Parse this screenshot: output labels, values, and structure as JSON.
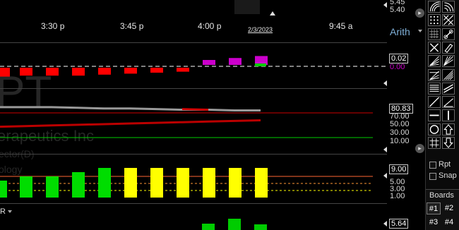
{
  "header": {
    "scale_top_a": "5.45",
    "scale_top_b": "5.40",
    "arith_label": "Arith"
  },
  "time_axis": {
    "labels": [
      "3:30 p",
      "3:45 p",
      "4:00 p",
      "9:45 a"
    ],
    "date_tag": "2/3/2023"
  },
  "ghost": {
    "ticker": "PT",
    "company": "erapeutics Inc",
    "sector": "ector(D)",
    "industry": "ology",
    "pane5_label": "R"
  },
  "pane2": {
    "value_box": "0.02",
    "zero_label": "0.00",
    "bars": [
      -0.9,
      -0.8,
      -0.8,
      -0.8,
      -0.7,
      -0.6,
      -0.5,
      -0.4,
      0.5,
      0.7,
      0.9
    ],
    "bar_colors": [
      "#ff0000",
      "#ff0000",
      "#ff0000",
      "#ff0000",
      "#ff0000",
      "#ff0000",
      "#ff0000",
      "#ff0000",
      "#cc00cc",
      "#cc00cc",
      "#cc00cc"
    ]
  },
  "pane3": {
    "value_box": "80.83",
    "scale_labels": [
      "70.00",
      "50.00",
      "30.00",
      "10.00"
    ],
    "line_gray": [
      0.86,
      0.86,
      0.86,
      0.85,
      0.84,
      0.84,
      0.83,
      0.82,
      0.82,
      0.81,
      0.81
    ],
    "line_red": [
      0.58,
      0.59,
      0.6,
      0.61,
      0.62,
      0.63,
      0.64,
      0.65,
      0.66,
      0.67,
      0.68
    ]
  },
  "pane4": {
    "value_box": "9.00",
    "scale_labels": [
      "5.00",
      "3.00",
      "1.00"
    ],
    "bars": [
      4,
      5,
      5,
      6,
      7,
      7,
      7,
      7,
      7,
      7,
      7
    ],
    "bar_colors": [
      "#00dd00",
      "#00dd00",
      "#00dd00",
      "#00dd00",
      "#00dd00",
      "#ffff00",
      "#ffff00",
      "#ffff00",
      "#ffff00",
      "#ffff00",
      "#ffff00"
    ]
  },
  "pane5": {
    "value_box": "5.64"
  },
  "colors": {
    "divider": "#444444",
    "scale_text": "#d8d8d8",
    "magenta_label": "#cc00cc",
    "red_line": "#cc0000",
    "green_line": "#00cc00",
    "orange_line": "#ff6633",
    "yellow_dash": "#ffff00"
  },
  "toolbar": {
    "tools": [
      "rainbow-arcs-icon",
      "fan-arcs-icon",
      "grid-dots-icon",
      "diagonal-grid-icon",
      "dotted-grid-icon",
      "link-icon",
      "cross-lines-icon",
      "pencil-icon",
      "fib-fan-icon",
      "gann-fan-icon",
      "speed-lines-icon",
      "triangle-lines-icon",
      "horizontal-lines-icon",
      "parallel-lines-icon",
      "trend-line-icon",
      "angled-line-icon",
      "horizontal-line-icon",
      "vertical-line-icon",
      "circle-icon",
      "up-arrow-icon",
      "cross-hatch-icon",
      "down-arrow-icon"
    ],
    "rpt_label": "Rpt",
    "snap_label": "Snap",
    "boards_label": "Boards",
    "boards": [
      "#1",
      "#2",
      "#3",
      "#4"
    ]
  }
}
